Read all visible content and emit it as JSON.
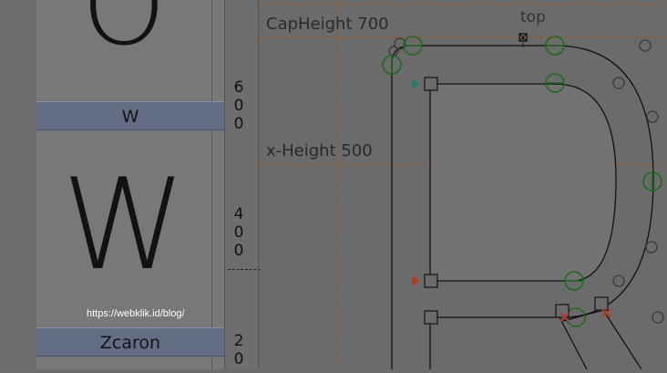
{
  "glyph_list": {
    "cells": [
      {
        "big_glyph": "O",
        "label": "W"
      },
      {
        "big_glyph": "W",
        "label": "Zcaron"
      }
    ],
    "watermark": "https://webklik.id/blog/"
  },
  "ruler": {
    "digits_600": [
      "6",
      "0",
      "0"
    ],
    "digits_400": [
      "4",
      "0",
      "0"
    ],
    "digits_200": [
      "2",
      "0"
    ]
  },
  "canvas": {
    "cap_height_label": "CapHeight 700",
    "x_height_label": "x-Height 500",
    "anchor_label": "top"
  },
  "colors": {
    "guide": "#a0501a",
    "oncurve": "#1f6a1f",
    "outline": "#111111",
    "label_bg": "#636d86"
  }
}
